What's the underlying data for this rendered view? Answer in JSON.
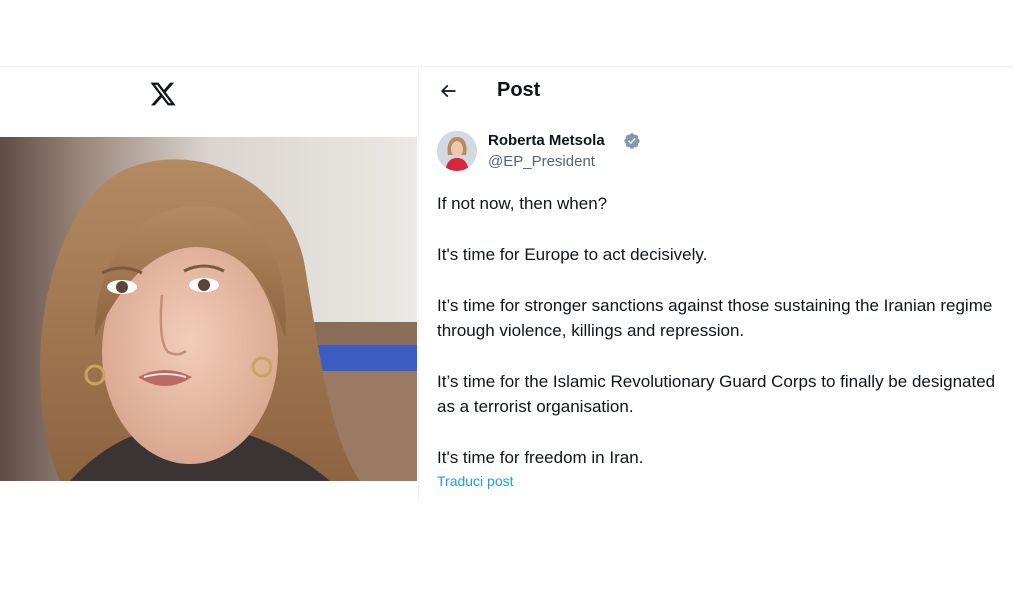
{
  "header": {
    "title": "Post"
  },
  "author": {
    "name": "Roberta Metsola",
    "handle": "@EP_President"
  },
  "tweet": {
    "paragraphs": [
      "If not now, then when?",
      "It's time for Europe to act decisively.",
      "It’s time for stronger sanctions against those sustaining the Iranian regime through violence, killings and repression.",
      "It’s time for the Islamic Revolutionary Guard Corps to finally be designated as a terrorist organisation.",
      "It's time for freedom in Iran."
    ],
    "translate_label": "Traduci post"
  },
  "icons": {
    "logo": "x-logo-icon",
    "back": "arrow-left-icon",
    "verified": "verified-badge-icon"
  },
  "colors": {
    "text": "#0f1419",
    "secondary": "#536471",
    "link": "#1d9bf0",
    "verified": "#829aab"
  }
}
